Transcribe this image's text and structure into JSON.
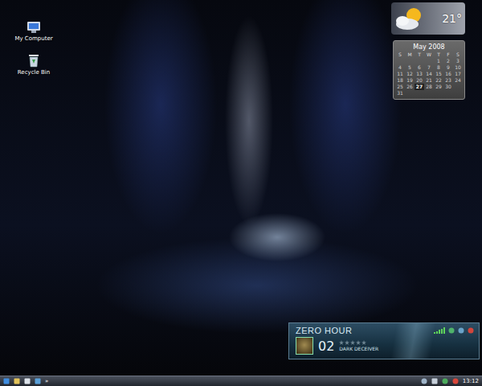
{
  "desktop_icons": [
    {
      "label": "My Computer",
      "kind": "computer"
    },
    {
      "label": "Recycle Bin",
      "kind": "recycle"
    }
  ],
  "weather": {
    "temperature": "21°"
  },
  "calendar": {
    "title": "May 2008",
    "weekdays": [
      "S",
      "M",
      "T",
      "W",
      "T",
      "F",
      "S"
    ],
    "weeks": [
      [
        {
          "day": "",
          "selected": false
        },
        {
          "day": "",
          "selected": false
        },
        {
          "day": "",
          "selected": false
        },
        {
          "day": "",
          "selected": false
        },
        {
          "day": "1",
          "selected": false
        },
        {
          "day": "2",
          "selected": false
        },
        {
          "day": "3",
          "selected": false
        }
      ],
      [
        {
          "day": "4",
          "selected": false
        },
        {
          "day": "5",
          "selected": false
        },
        {
          "day": "6",
          "selected": false
        },
        {
          "day": "7",
          "selected": false
        },
        {
          "day": "8",
          "selected": false
        },
        {
          "day": "9",
          "selected": false
        },
        {
          "day": "10",
          "selected": false
        }
      ],
      [
        {
          "day": "11",
          "selected": false
        },
        {
          "day": "12",
          "selected": false
        },
        {
          "day": "13",
          "selected": false
        },
        {
          "day": "14",
          "selected": false
        },
        {
          "day": "15",
          "selected": false
        },
        {
          "day": "16",
          "selected": false
        },
        {
          "day": "17",
          "selected": false
        }
      ],
      [
        {
          "day": "18",
          "selected": false
        },
        {
          "day": "19",
          "selected": false
        },
        {
          "day": "20",
          "selected": false
        },
        {
          "day": "21",
          "selected": false
        },
        {
          "day": "22",
          "selected": false
        },
        {
          "day": "23",
          "selected": false
        },
        {
          "day": "24",
          "selected": false
        }
      ],
      [
        {
          "day": "25",
          "selected": false
        },
        {
          "day": "26",
          "selected": false
        },
        {
          "day": "27",
          "selected": true
        },
        {
          "day": "28",
          "selected": false
        },
        {
          "day": "29",
          "selected": false
        },
        {
          "day": "30",
          "selected": false
        }
      ],
      [
        {
          "day": "31",
          "selected": false
        }
      ]
    ]
  },
  "player": {
    "title": "ZERO HOUR",
    "track_number": "02",
    "stars": 0,
    "track": "DARK DECEIVER",
    "signal_level": 1
  },
  "taskbar": {
    "overflow": "»",
    "clock": "13:12"
  }
}
